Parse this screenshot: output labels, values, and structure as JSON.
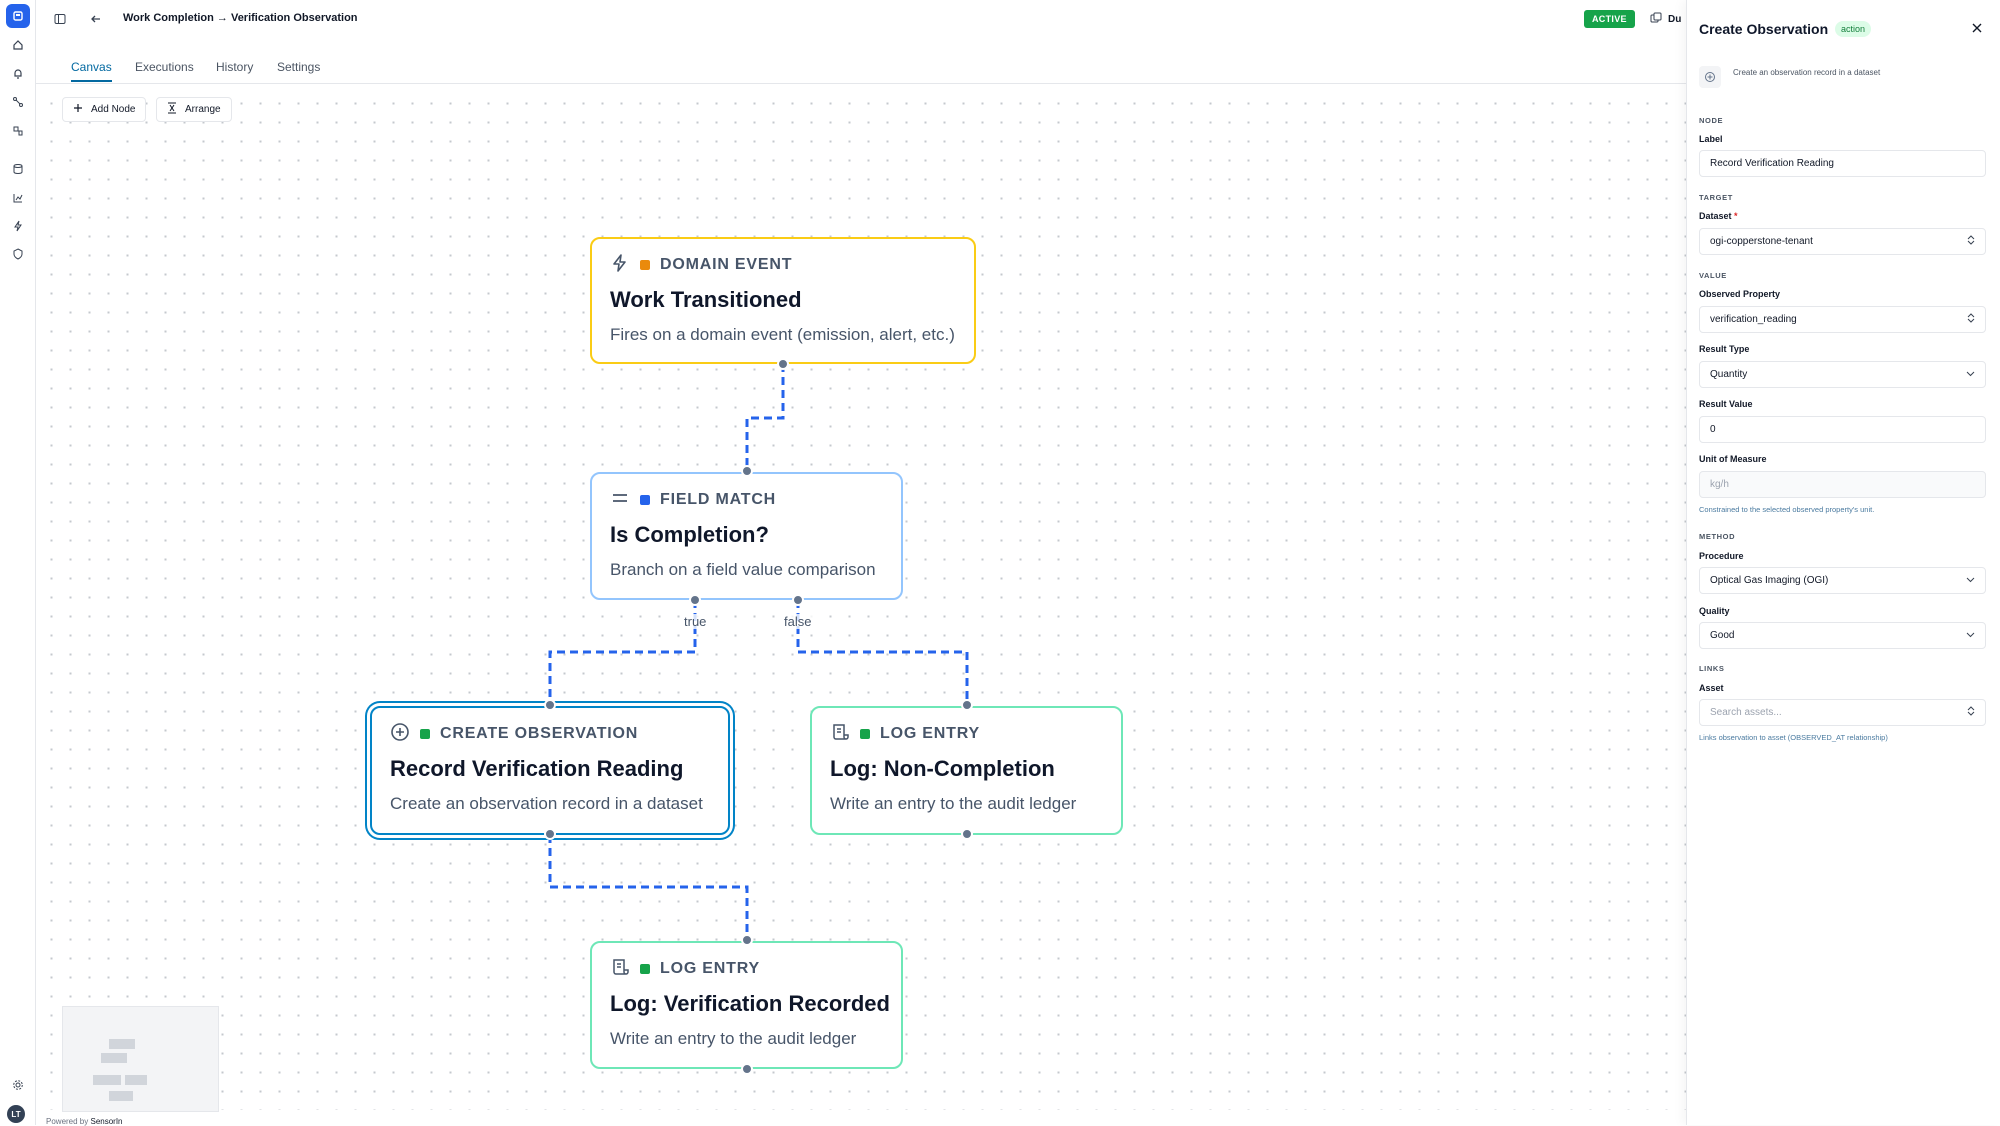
{
  "topbar": {
    "title": "Work Completion → Verification Observation",
    "status": "ACTIVE",
    "duplicate_label": "Du"
  },
  "tabs": [
    {
      "label": "Canvas",
      "active": true
    },
    {
      "label": "Executions",
      "active": false
    },
    {
      "label": "History",
      "active": false
    },
    {
      "label": "Settings",
      "active": false
    }
  ],
  "toolbar": {
    "add_node": "Add Node",
    "arrange": "Arrange"
  },
  "nodes": {
    "domain_event": {
      "kind": "DOMAIN EVENT",
      "title": "Work Transitioned",
      "desc": "Fires on a domain event (emission, alert, etc.)",
      "dot": "#ea8a0c",
      "border": "#facc15",
      "icon": "bolt-icon"
    },
    "field_match": {
      "kind": "FIELD MATCH",
      "title": "Is Completion?",
      "desc": "Branch on a field value comparison",
      "dot": "#2563eb",
      "border": "#93c5fd",
      "icon": "equals-icon"
    },
    "create_obs": {
      "kind": "CREATE OBSERVATION",
      "title": "Record Verification Reading",
      "desc": "Create an observation record in a dataset",
      "dot": "#16a34a",
      "border": "#0284c7",
      "icon": "plus-circle-icon"
    },
    "log_noncompletion": {
      "kind": "LOG ENTRY",
      "title": "Log: Non-Completion",
      "desc": "Write an entry to the audit ledger",
      "dot": "#16a34a",
      "border": "#6ee7b7",
      "icon": "scroll-icon"
    },
    "log_recorded": {
      "kind": "LOG ENTRY",
      "title": "Log: Verification Recorded",
      "desc": "Write an entry to the audit ledger",
      "dot": "#16a34a",
      "border": "#6ee7b7",
      "icon": "scroll-icon"
    }
  },
  "edge_labels": {
    "true": "true",
    "false": "false"
  },
  "footer": {
    "powered": "Powered by",
    "brand": "SensorIn"
  },
  "user": {
    "initials": "LT"
  },
  "panel": {
    "title": "Create Observation",
    "badge": "action",
    "description": "Create an observation record in a dataset",
    "sections": {
      "node": "NODE",
      "target": "TARGET",
      "value": "VALUE",
      "method": "METHOD",
      "links": "LINKS"
    },
    "label_label": "Label",
    "label_value": "Record Verification Reading",
    "dataset_label": "Dataset",
    "dataset_required": "*",
    "dataset_value": "ogi-copperstone-tenant",
    "observed_property_label": "Observed Property",
    "observed_property_value": "verification_reading",
    "result_type_label": "Result Type",
    "result_type_value": "Quantity",
    "result_value_label": "Result Value",
    "result_value_value": "0",
    "unit_label": "Unit of Measure",
    "unit_placeholder": "kg/h",
    "unit_hint": "Constrained to the selected observed property's unit.",
    "procedure_label": "Procedure",
    "procedure_value": "Optical Gas Imaging (OGI)",
    "quality_label": "Quality",
    "quality_value": "Good",
    "asset_label": "Asset",
    "asset_placeholder": "Search assets...",
    "asset_hint": "Links observation to asset (OBSERVED_AT relationship)"
  },
  "colors": {
    "accent": "#0284c7",
    "active": "#16a34a",
    "edge": "#2563eb"
  }
}
